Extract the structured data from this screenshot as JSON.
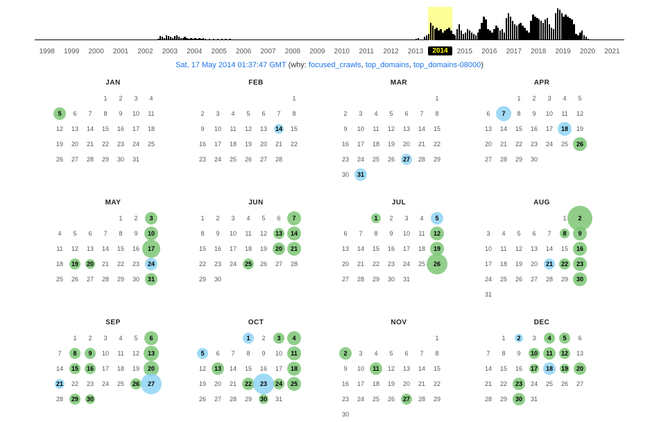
{
  "sparkline": {
    "years": [
      "1998",
      "1999",
      "2000",
      "2001",
      "2002",
      "2003",
      "2004",
      "2005",
      "2006",
      "2007",
      "2008",
      "2009",
      "2010",
      "2011",
      "2012",
      "2013",
      "2014",
      "2015",
      "2016",
      "2017",
      "2018",
      "2019",
      "2020",
      "2021"
    ],
    "selected_year": "2014",
    "bars": [
      0,
      0,
      0,
      0,
      0,
      0,
      0,
      0,
      0,
      0,
      0,
      0,
      0,
      0,
      0,
      0,
      0,
      0,
      0,
      0,
      0,
      0,
      0,
      0,
      0,
      0,
      0,
      0,
      0,
      0,
      0,
      0,
      0,
      0,
      0,
      0,
      0,
      0,
      0,
      0,
      0,
      0,
      0,
      0,
      0,
      0,
      0,
      0,
      0,
      0,
      0,
      0,
      0,
      0,
      0,
      0,
      0,
      0,
      0,
      0,
      2,
      5,
      4,
      3,
      6,
      5,
      4,
      3,
      5,
      6,
      4,
      3,
      3,
      4,
      3,
      2,
      3,
      2,
      3,
      2,
      3,
      2,
      3,
      2,
      1,
      2,
      1,
      2,
      1,
      2,
      1,
      2,
      1,
      2,
      1,
      2,
      0,
      0,
      0,
      0,
      0,
      0,
      0,
      0,
      0,
      0,
      0,
      0,
      0,
      0,
      0,
      0,
      0,
      0,
      0,
      0,
      0,
      0,
      0,
      0,
      0,
      0,
      0,
      0,
      0,
      0,
      0,
      0,
      0,
      0,
      0,
      0,
      0,
      0,
      0,
      0,
      0,
      0,
      0,
      0,
      0,
      0,
      0,
      0,
      0,
      0,
      0,
      0,
      0,
      0,
      0,
      0,
      0,
      0,
      0,
      0,
      0,
      0,
      0,
      0,
      0,
      0,
      0,
      0,
      0,
      0,
      0,
      0,
      0,
      0,
      0,
      0,
      0,
      0,
      0,
      0,
      0,
      0,
      0,
      0,
      0,
      0,
      0,
      0,
      0,
      0,
      2,
      3,
      0,
      0,
      4,
      6,
      8,
      22,
      18,
      14,
      16,
      12,
      14,
      10,
      12,
      14,
      16,
      12,
      8,
      6,
      14,
      20,
      12,
      8,
      10,
      14,
      12,
      10,
      8,
      6,
      10,
      14,
      22,
      30,
      26,
      14,
      12,
      10,
      14,
      18,
      16,
      12,
      14,
      10,
      28,
      34,
      30,
      24,
      20,
      18,
      20,
      22,
      18,
      16,
      12,
      10,
      24,
      32,
      30,
      28,
      26,
      24,
      22,
      26,
      28,
      20,
      16,
      14,
      34,
      40,
      38,
      34,
      30,
      32,
      30,
      28,
      26,
      20,
      8,
      6,
      10,
      12,
      6,
      4,
      2,
      0,
      0,
      0,
      0,
      0,
      0,
      0,
      0,
      0,
      0,
      0,
      0,
      0,
      0,
      0,
      0,
      0
    ]
  },
  "caption": {
    "datetime": "Sat, 17 May 2014 01:37:47 GMT",
    "why_label": "(why:",
    "links": [
      "focused_crawls",
      "top_domains",
      "top_domains-08000"
    ],
    "close": ")"
  },
  "months": [
    {
      "name": "JAN",
      "start": 3,
      "days": 31,
      "captures": [
        {
          "d": 5,
          "c": "g",
          "s": 18
        }
      ]
    },
    {
      "name": "FEB",
      "start": 6,
      "days": 28,
      "captures": [
        {
          "d": 14,
          "c": "b",
          "s": 14
        }
      ]
    },
    {
      "name": "MAR",
      "start": 6,
      "days": 31,
      "captures": [
        {
          "d": 27,
          "c": "b",
          "s": 16
        },
        {
          "d": 31,
          "c": "b",
          "s": 18
        }
      ]
    },
    {
      "name": "APR",
      "start": 2,
      "days": 30,
      "captures": [
        {
          "d": 7,
          "c": "b",
          "s": 22
        },
        {
          "d": 18,
          "c": "b",
          "s": 20
        },
        {
          "d": 26,
          "c": "g",
          "s": 20
        }
      ]
    },
    {
      "name": "MAY",
      "start": 4,
      "days": 31,
      "captures": [
        {
          "d": 3,
          "c": "g",
          "s": 18
        },
        {
          "d": 10,
          "c": "g",
          "s": 20
        },
        {
          "d": 17,
          "c": "g",
          "s": 26
        },
        {
          "d": 19,
          "c": "g",
          "s": 16
        },
        {
          "d": 20,
          "c": "g",
          "s": 14
        },
        {
          "d": 24,
          "c": "b",
          "s": 18
        },
        {
          "d": 31,
          "c": "g",
          "s": 18
        }
      ]
    },
    {
      "name": "JUN",
      "start": 0,
      "days": 30,
      "captures": [
        {
          "d": 7,
          "c": "g",
          "s": 20
        },
        {
          "d": 13,
          "c": "g",
          "s": 16
        },
        {
          "d": 14,
          "c": "g",
          "s": 20
        },
        {
          "d": 20,
          "c": "g",
          "s": 18
        },
        {
          "d": 21,
          "c": "g",
          "s": 20
        },
        {
          "d": 25,
          "c": "g",
          "s": 16
        }
      ]
    },
    {
      "name": "JUL",
      "start": 2,
      "days": 31,
      "captures": [
        {
          "d": 1,
          "c": "g",
          "s": 14
        },
        {
          "d": 5,
          "c": "b",
          "s": 18
        },
        {
          "d": 12,
          "c": "g",
          "s": 20
        },
        {
          "d": 19,
          "c": "g",
          "s": 20
        },
        {
          "d": 26,
          "c": "g",
          "s": 30
        }
      ]
    },
    {
      "name": "AUG",
      "start": 5,
      "days": 31,
      "captures": [
        {
          "d": 2,
          "c": "g",
          "s": 36
        },
        {
          "d": 8,
          "c": "g",
          "s": 14
        },
        {
          "d": 9,
          "c": "g",
          "s": 20
        },
        {
          "d": 16,
          "c": "g",
          "s": 20
        },
        {
          "d": 21,
          "c": "b",
          "s": 16
        },
        {
          "d": 22,
          "c": "g",
          "s": 16
        },
        {
          "d": 23,
          "c": "g",
          "s": 20
        },
        {
          "d": 30,
          "c": "g",
          "s": 20
        }
      ]
    },
    {
      "name": "SEP",
      "start": 1,
      "days": 30,
      "captures": [
        {
          "d": 6,
          "c": "g",
          "s": 20
        },
        {
          "d": 8,
          "c": "g",
          "s": 16
        },
        {
          "d": 9,
          "c": "g",
          "s": 16
        },
        {
          "d": 13,
          "c": "g",
          "s": 22
        },
        {
          "d": 15,
          "c": "g",
          "s": 16
        },
        {
          "d": 16,
          "c": "g",
          "s": 16
        },
        {
          "d": 20,
          "c": "g",
          "s": 22
        },
        {
          "d": 21,
          "c": "b",
          "s": 14
        },
        {
          "d": 26,
          "c": "g",
          "s": 16
        },
        {
          "d": 27,
          "c": "b",
          "s": 30
        },
        {
          "d": 29,
          "c": "g",
          "s": 16
        },
        {
          "d": 30,
          "c": "g",
          "s": 14
        }
      ]
    },
    {
      "name": "OCT",
      "start": 3,
      "days": 31,
      "captures": [
        {
          "d": 1,
          "c": "b",
          "s": 16
        },
        {
          "d": 3,
          "c": "g",
          "s": 16
        },
        {
          "d": 4,
          "c": "g",
          "s": 20
        },
        {
          "d": 5,
          "c": "b",
          "s": 16
        },
        {
          "d": 11,
          "c": "g",
          "s": 20
        },
        {
          "d": 13,
          "c": "g",
          "s": 18
        },
        {
          "d": 18,
          "c": "g",
          "s": 20
        },
        {
          "d": 22,
          "c": "g",
          "s": 18
        },
        {
          "d": 23,
          "c": "b",
          "s": 30
        },
        {
          "d": 24,
          "c": "g",
          "s": 16
        },
        {
          "d": 25,
          "c": "g",
          "s": 20
        },
        {
          "d": 30,
          "c": "g",
          "s": 14
        }
      ]
    },
    {
      "name": "NOV",
      "start": 6,
      "days": 30,
      "captures": [
        {
          "d": 2,
          "c": "g",
          "s": 18
        },
        {
          "d": 11,
          "c": "g",
          "s": 18
        },
        {
          "d": 27,
          "c": "g",
          "s": 16
        }
      ]
    },
    {
      "name": "DEC",
      "start": 1,
      "days": 31,
      "captures": [
        {
          "d": 2,
          "c": "b",
          "s": 12
        },
        {
          "d": 4,
          "c": "g",
          "s": 16
        },
        {
          "d": 5,
          "c": "g",
          "s": 16
        },
        {
          "d": 10,
          "c": "g",
          "s": 16
        },
        {
          "d": 11,
          "c": "g",
          "s": 18
        },
        {
          "d": 12,
          "c": "g",
          "s": 16
        },
        {
          "d": 17,
          "c": "g",
          "s": 14
        },
        {
          "d": 18,
          "c": "b",
          "s": 18
        },
        {
          "d": 19,
          "c": "g",
          "s": 14
        },
        {
          "d": 20,
          "c": "g",
          "s": 18
        },
        {
          "d": 23,
          "c": "g",
          "s": 18
        },
        {
          "d": 30,
          "c": "g",
          "s": 18
        }
      ]
    }
  ]
}
